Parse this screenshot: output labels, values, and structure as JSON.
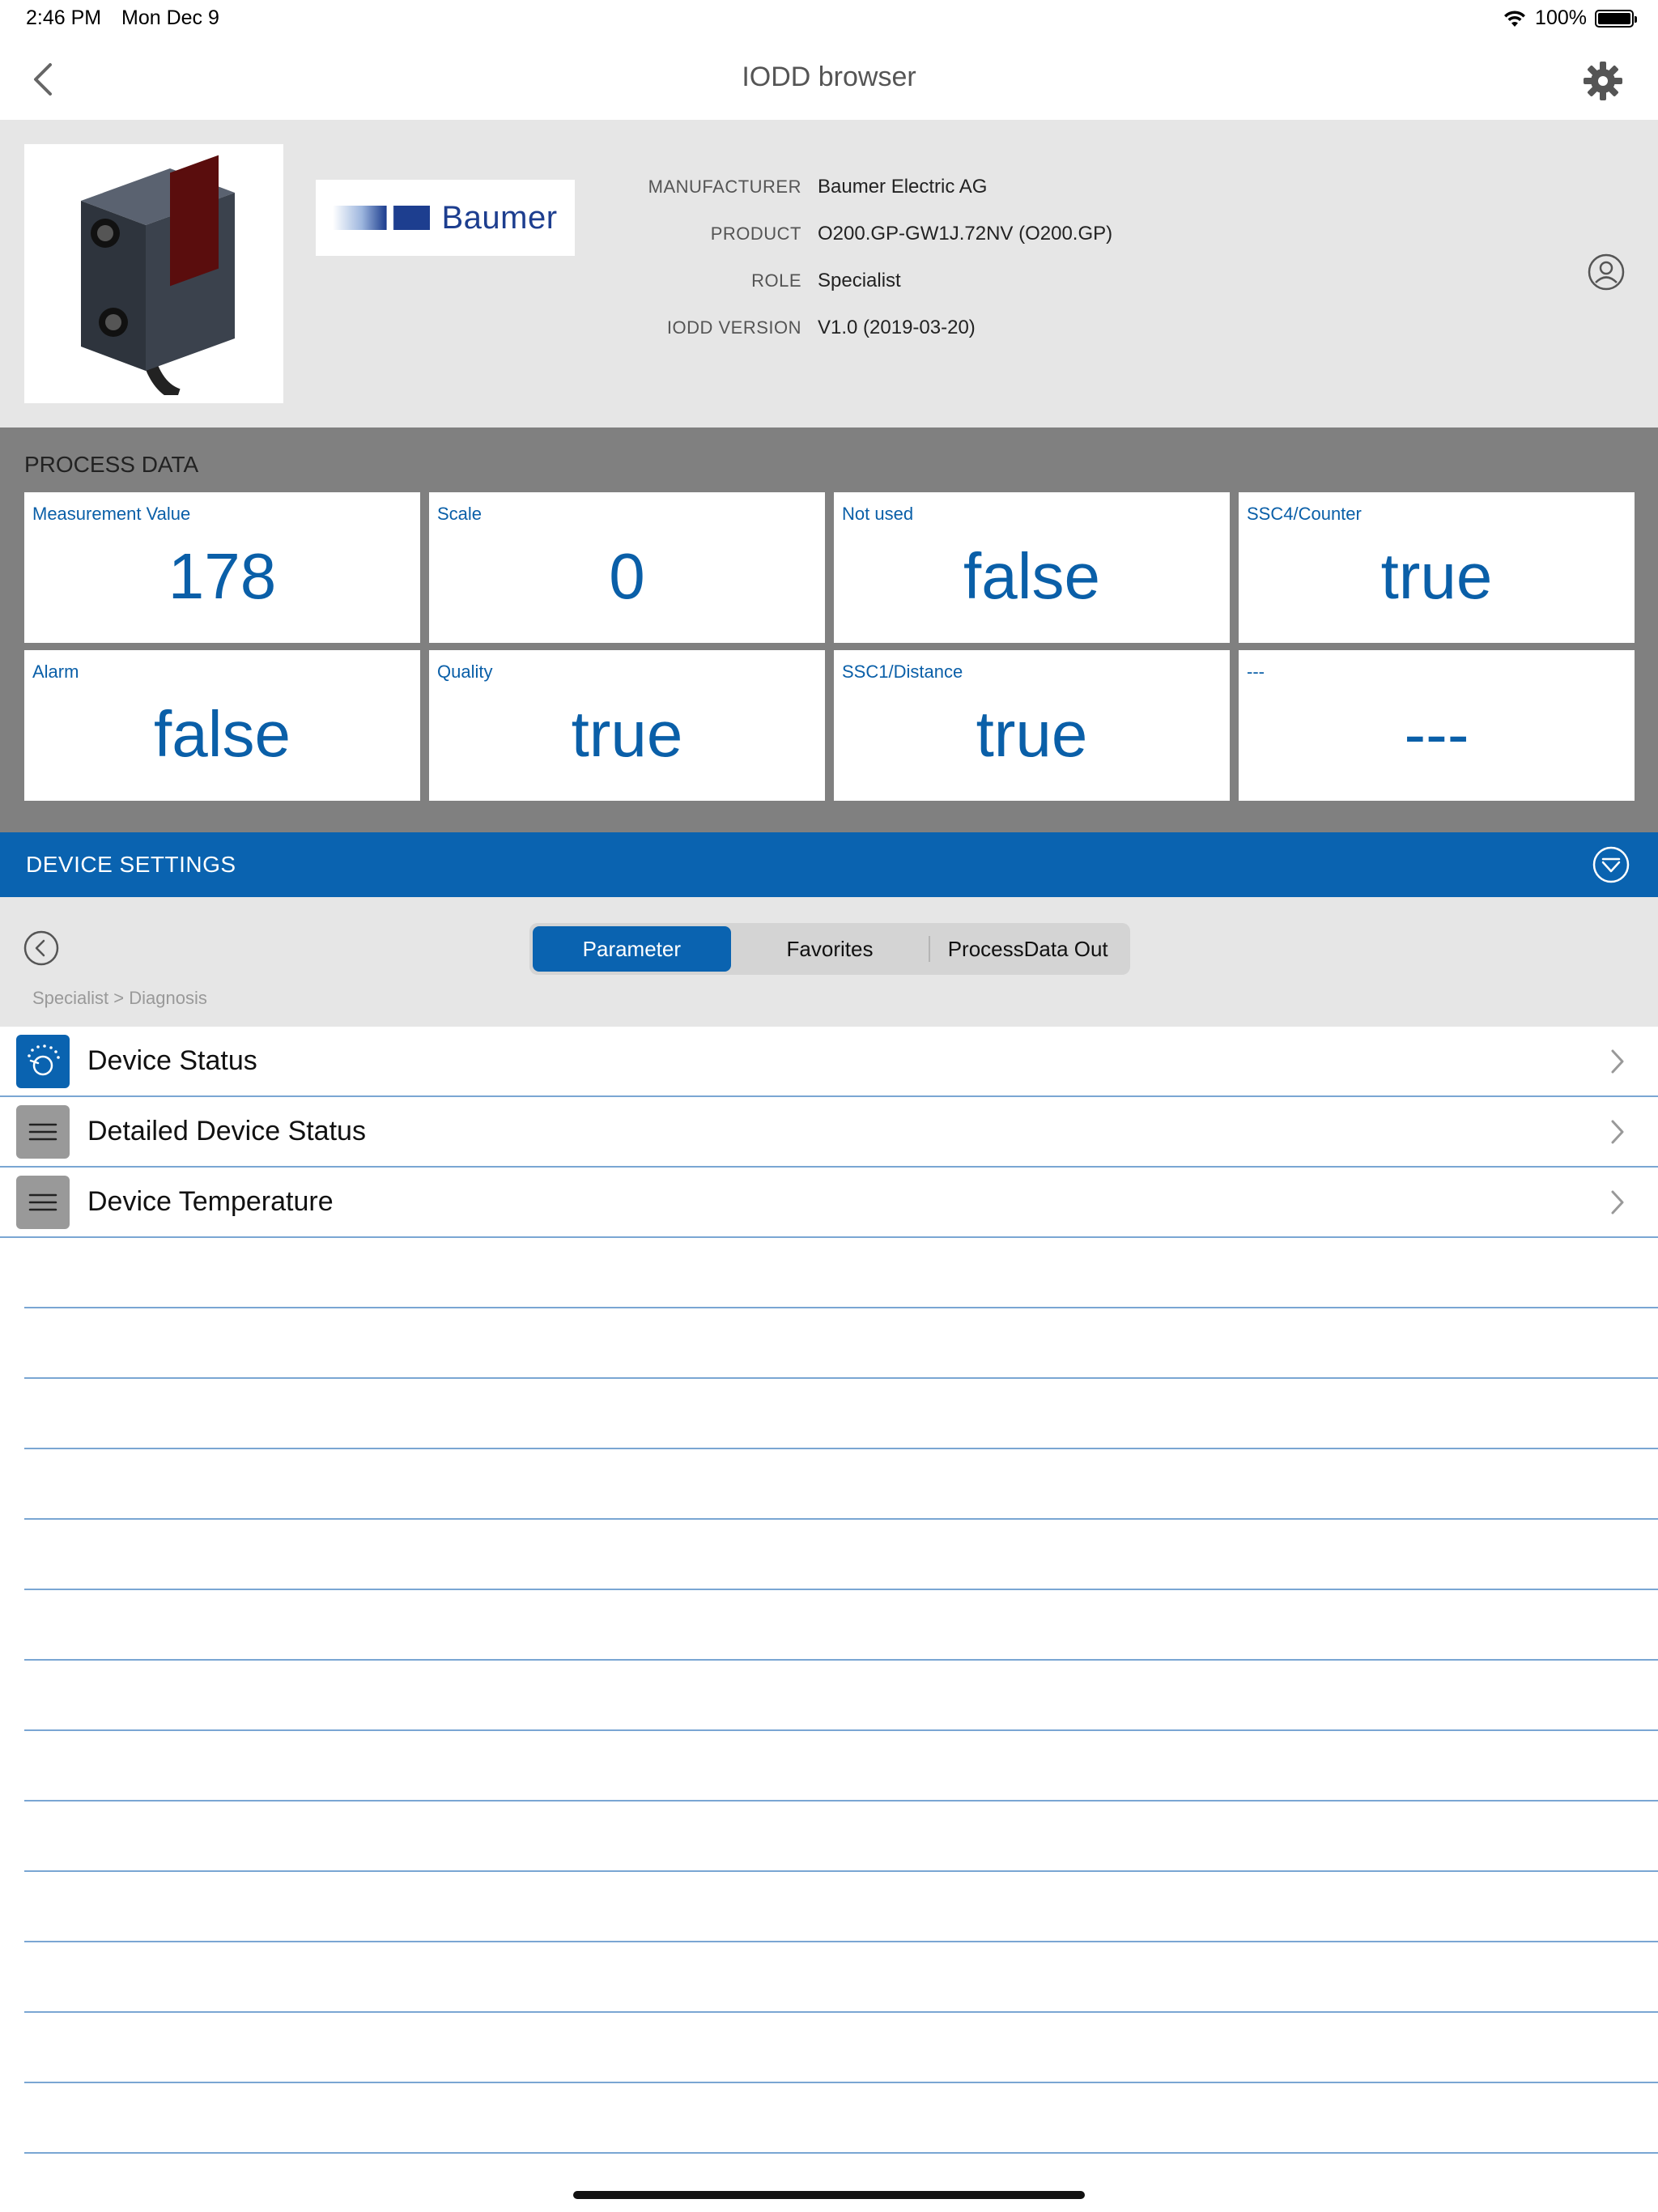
{
  "status_bar": {
    "time": "2:46 PM",
    "date": "Mon Dec 9",
    "battery": "100%",
    "battery_level": 1.0
  },
  "nav": {
    "title": "IODD browser",
    "back_icon": "chevron-left-icon",
    "settings_icon": "gear-icon"
  },
  "device": {
    "brand": "Baumer",
    "manufacturer_label": "MANUFACTURER",
    "manufacturer": "Baumer Electric AG",
    "product_label": "PRODUCT",
    "product": "O200.GP-GW1J.72NV (O200.GP)",
    "role_label": "ROLE",
    "role": "Specialist",
    "iodd_label": "IODD VERSION",
    "iodd_version": "V1.0 (2019-03-20)"
  },
  "process_data": {
    "title": "PROCESS DATA",
    "cells": [
      {
        "label": "Measurement Value",
        "value": "178"
      },
      {
        "label": "Scale",
        "value": "0"
      },
      {
        "label": "Not used",
        "value": "false"
      },
      {
        "label": "SSC4/Counter",
        "value": "true"
      },
      {
        "label": "Alarm",
        "value": "false"
      },
      {
        "label": "Quality",
        "value": "true"
      },
      {
        "label": "SSC1/Distance",
        "value": "true"
      },
      {
        "label": "---",
        "value": "---"
      }
    ]
  },
  "settings": {
    "title": "DEVICE SETTINGS",
    "tabs": [
      {
        "label": "Parameter",
        "active": true
      },
      {
        "label": "Favorites",
        "active": false
      },
      {
        "label": "ProcessData Out",
        "active": false
      }
    ],
    "breadcrumb": "Specialist > Diagnosis",
    "items": [
      {
        "label": "Device Status",
        "icon": "gauge-icon"
      },
      {
        "label": "Detailed Device Status",
        "icon": "menu-icon"
      },
      {
        "label": "Device Temperature",
        "icon": "menu-icon"
      }
    ]
  },
  "colors": {
    "accent": "#0a63b0",
    "value_text": "#0a5fa8",
    "header_bg": "#e6e6e6",
    "process_bg": "#808080"
  }
}
